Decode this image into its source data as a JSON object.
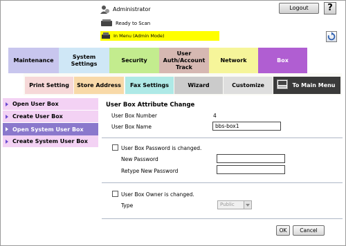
{
  "header": {
    "user_label": "Administrator",
    "logout_label": "Logout",
    "help_label": "?",
    "status_text": "Ready to Scan",
    "mode_text": "In Menu (Admin Mode)"
  },
  "tabs": [
    {
      "label": "Maintenance"
    },
    {
      "label": "System Settings"
    },
    {
      "label": "Security"
    },
    {
      "label": "User Auth/Account Track"
    },
    {
      "label": "Network"
    },
    {
      "label": "Box"
    }
  ],
  "subtabs": [
    {
      "label": "Print Setting"
    },
    {
      "label": "Store Address"
    },
    {
      "label": "Fax Settings"
    },
    {
      "label": "Wizard"
    },
    {
      "label": "Customize"
    },
    {
      "label": "To Main Menu"
    }
  ],
  "sidebar": {
    "items": [
      {
        "label": "Open User Box"
      },
      {
        "label": "Create User Box"
      },
      {
        "label": "Open System User Box"
      },
      {
        "label": "Create System User Box"
      }
    ]
  },
  "content": {
    "title": "User Box Attribute Change",
    "box_number_label": "User Box Number",
    "box_number_value": "4",
    "box_name_label": "User Box Name",
    "box_name_value": "bbs-box1",
    "password_changed_label": "User Box Password is changed.",
    "new_password_label": "New Password",
    "retype_password_label": "Retype New Password",
    "owner_changed_label": "User Box Owner is changed.",
    "type_label": "Type",
    "type_value": "Public",
    "ok_label": "OK",
    "cancel_label": "Cancel"
  },
  "colors": {
    "box_tab": "#b05ed2",
    "sidebar_active": "#8a78cc",
    "mode_bar": "#ffff00"
  }
}
